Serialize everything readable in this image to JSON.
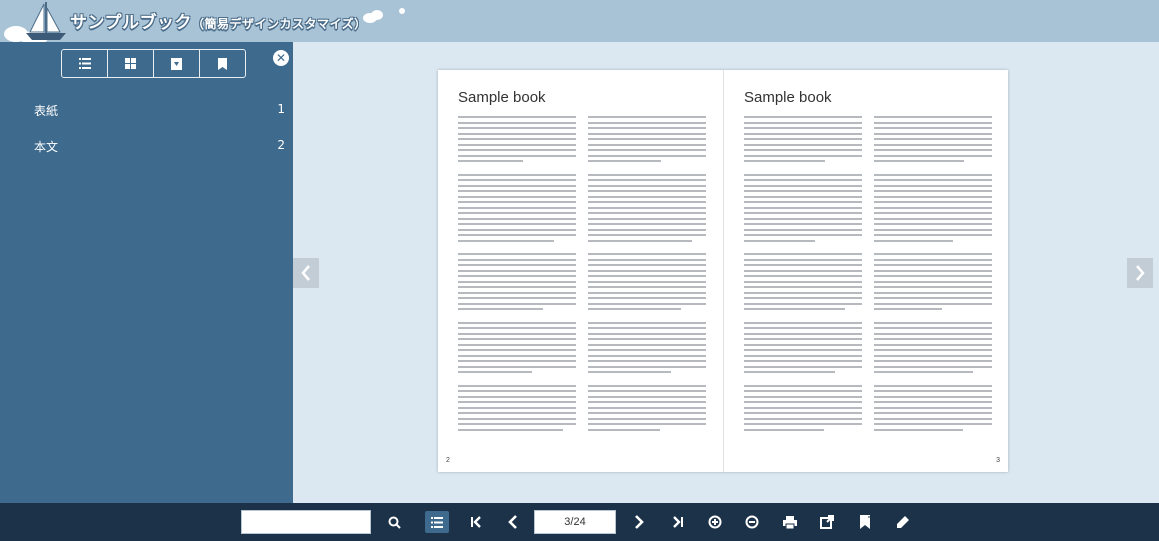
{
  "header": {
    "title": "サンプルブック",
    "subtitle": "（簡易デザインカスタマイズ）"
  },
  "colors": {
    "header_bg": "#a9c3d6",
    "sidebar_bg": "#3e6a8d",
    "viewer_bg": "#dbe8f2",
    "toolbar_bg": "#1b3248"
  },
  "sidebar": {
    "tools": [
      {
        "name": "toc-list-icon"
      },
      {
        "name": "thumbnail-grid-icon"
      },
      {
        "name": "download-icon"
      },
      {
        "name": "bookmark-icon"
      }
    ],
    "close_icon": "close-icon",
    "toc": [
      {
        "label": "表紙",
        "page": "1"
      },
      {
        "label": "本文",
        "page": "2"
      }
    ]
  },
  "book": {
    "left_page": {
      "title": "Sample book",
      "number": "2"
    },
    "right_page": {
      "title": "Sample book",
      "number": "3"
    }
  },
  "toolbar": {
    "search_placeholder": "",
    "page_indicator": "3/24",
    "icons": [
      "search-icon",
      "toc-list-icon",
      "first-page-icon",
      "prev-page-icon",
      "next-page-icon",
      "last-page-icon",
      "zoom-in-icon",
      "zoom-out-icon",
      "print-icon",
      "export-icon",
      "bookmark-add-icon",
      "marker-icon"
    ]
  }
}
